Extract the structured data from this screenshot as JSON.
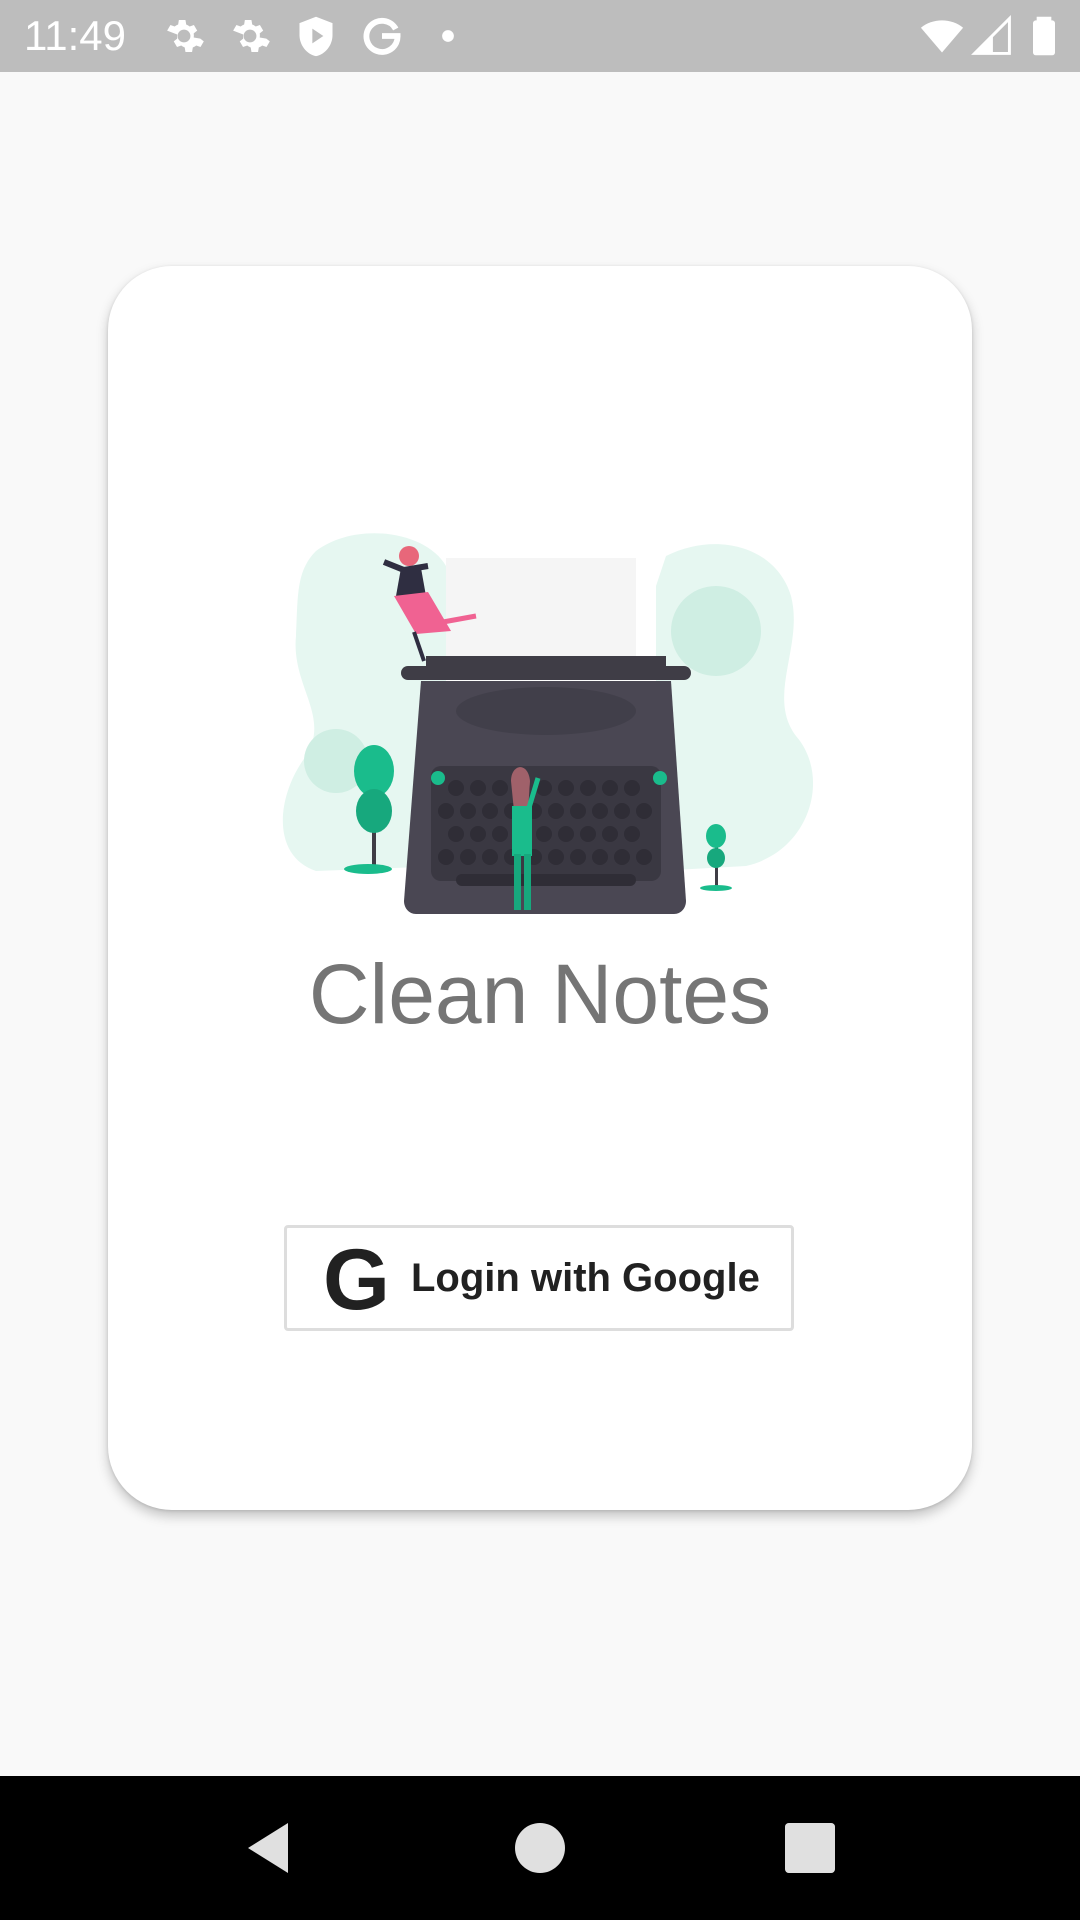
{
  "status_bar": {
    "time": "11:49",
    "left_icons": [
      "settings-icon",
      "settings-icon",
      "shield-play-icon",
      "google-icon",
      "dot-icon"
    ],
    "right_icons": [
      "wifi-icon",
      "cellular-signal-icon",
      "battery-icon"
    ]
  },
  "login_card": {
    "illustration": "typewriter-illustration",
    "title": "Clean Notes",
    "google_button": {
      "icon_letter": "G",
      "label": "Login with Google"
    }
  },
  "nav_bar": {
    "buttons": [
      "back-icon",
      "home-icon",
      "recents-icon"
    ]
  },
  "colors": {
    "accent_green": "#1abc8c",
    "title_gray": "#757575",
    "status_bar": "#bdbdbd"
  }
}
